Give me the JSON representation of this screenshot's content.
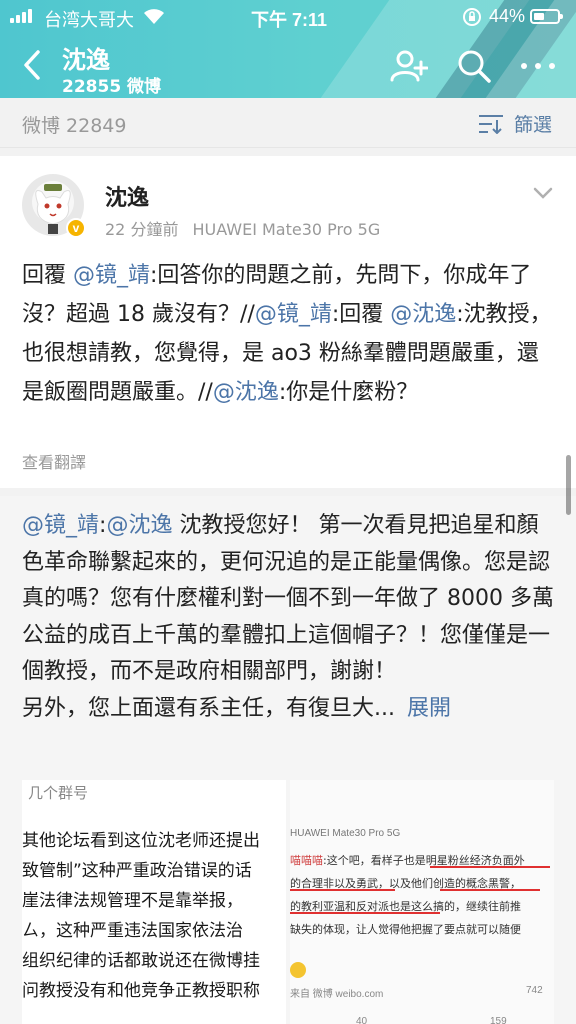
{
  "status_bar": {
    "carrier": "台湾大哥大",
    "time": "下午 7:11",
    "battery_percent": "44%",
    "battery_level": 0.44
  },
  "nav": {
    "title": "沈逸",
    "subtitle": "22855 微博",
    "icons": [
      "back-icon",
      "add-follow-icon",
      "search-icon",
      "more-icon"
    ]
  },
  "toolbar": {
    "weibo_count": "微博 22849",
    "filter_label": "篩選"
  },
  "post": {
    "author": "沈逸",
    "verified_badge": "v",
    "time": "22 分鐘前",
    "device": "HUAWEI Mate30 Pro 5G",
    "segments": [
      {
        "t": "回覆 ",
        "link": false
      },
      {
        "t": "@镜_靖",
        "link": true
      },
      {
        "t": ":回答你的問題之前，先問下，你成年了沒？超過 18 歲沒有？//",
        "link": false
      },
      {
        "t": "@镜_靖",
        "link": true
      },
      {
        "t": ":回覆 ",
        "link": false
      },
      {
        "t": "@沈逸",
        "link": true
      },
      {
        "t": ":沈教授，也很想請教，您覺得，是 ao3 粉絲羣體問題嚴重，還是飯圈問題嚴重。//",
        "link": false
      },
      {
        "t": "@沈逸",
        "link": true
      },
      {
        "t": ":你是什麼粉？",
        "link": false
      }
    ],
    "translate_label": "查看翻譯"
  },
  "repost": {
    "segments": [
      {
        "t": "@镜_靖",
        "link": true
      },
      {
        "t": ":",
        "link": false
      },
      {
        "t": "@沈逸",
        "link": true
      },
      {
        "t": " 沈教授您好！ 第一次看見把追星和顏色革命聯繫起來的，更何況追的是正能量偶像。您是認真的嗎？您有什麼權利對一個不到一年做了 8000 多萬公益的成百上千萬的羣體扣上這個帽子？！您僅僅是一個教授，而不是政府相關部門，謝謝！",
        "link": false
      },
      {
        "t": "\n另外，您上面還有系主任，有復旦大...",
        "link": false
      }
    ],
    "expand_label": "展開",
    "image1": {
      "header": "几个群号",
      "lines": [
        "其他论坛看到这位沈老师还提出",
        "致管制”这种严重政治错误的话",
        "崖法律法规管理不是靠举报，",
        "ㄙ，这种严重违法国家依法治",
        "组织纪律的话都敢说还在微博挂",
        "问教授没有和他竞争正教授职称"
      ]
    },
    "image2": {
      "device": "HUAWEI Mate30 Pro 5G",
      "user": "喵喵喵",
      "lines": [
        ":这个吧，看样子也是明星粉丝经济负面外",
        "的合理非以及勇武，以及他们创造的概念黑警，",
        "的教利亚温和反对派也是这么搞的，继续往前推",
        "缺失的体现，让人觉得他把握了要点就可以随便"
      ],
      "source": "来自 微博 weibo.com",
      "share_count": "742",
      "bottom_left": "40",
      "bottom_right": "159"
    }
  }
}
